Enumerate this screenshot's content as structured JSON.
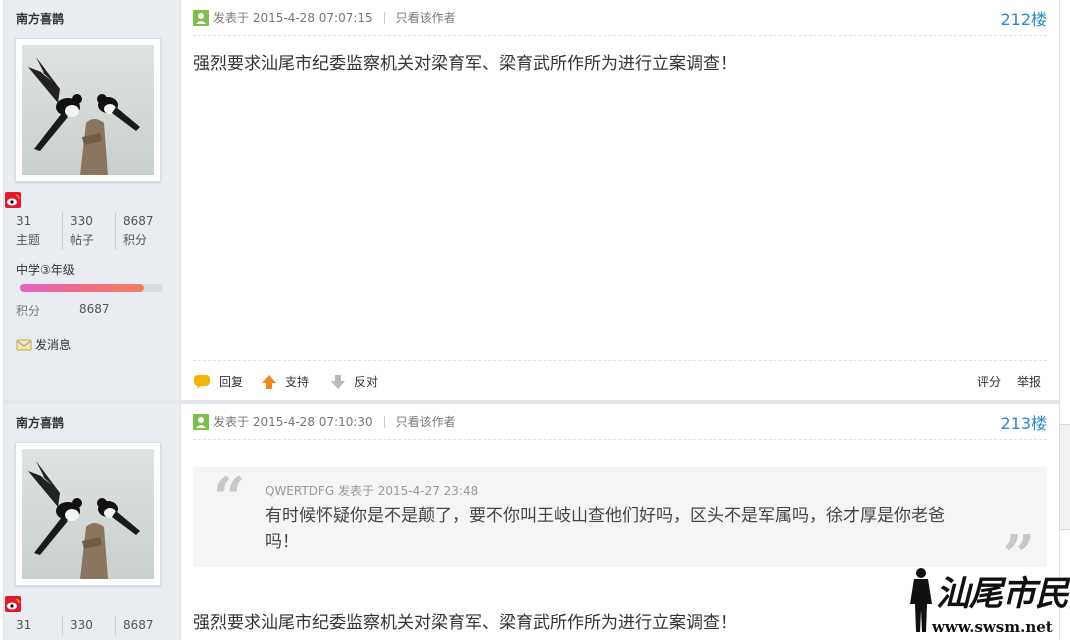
{
  "posts": [
    {
      "author": "南方喜鹊",
      "stats": [
        {
          "num": "31",
          "label": "主题"
        },
        {
          "num": "330",
          "label": "帖子"
        },
        {
          "num": "8687",
          "label": "积分"
        }
      ],
      "rank": "中学③年级",
      "rank_progress": 0.87,
      "score_label": "积分",
      "score_value": "8687",
      "send_message": "发消息",
      "posted_prefix": "发表于",
      "posted_time": "2015-4-28 07:07:15",
      "only_author": "只看该作者",
      "floor": "212楼",
      "content": "强烈要求汕尾市纪委监察机关对梁育军、梁育武所作所为进行立案调查！",
      "actions": {
        "reply": "回复",
        "support": "支持",
        "oppose": "反对",
        "rate": "评分",
        "report": "举报"
      }
    },
    {
      "author": "南方喜鹊",
      "stats": [
        {
          "num": "31"
        },
        {
          "num": "330"
        },
        {
          "num": "8687"
        }
      ],
      "posted_prefix": "发表于",
      "posted_time": "2015-4-28 07:10:30",
      "only_author": "只看该作者",
      "floor": "213楼",
      "quote": {
        "header": "QWERTDFG 发表于 2015-4-27 23:48",
        "text": "有时候怀疑你是不是颠了，要不你叫王岐山查他们好吗，区头不是军属吗，徐才厚是你老爸吗！"
      },
      "content": "强烈要求汕尾市纪委监察机关对梁育军、梁育武所作所为进行立案调查！"
    }
  ],
  "watermark": {
    "title": "汕尾市民网",
    "url": "www.swsm.net"
  },
  "colors": {
    "floor": "#2a8ac9",
    "sidebar": "#e9edf1"
  }
}
